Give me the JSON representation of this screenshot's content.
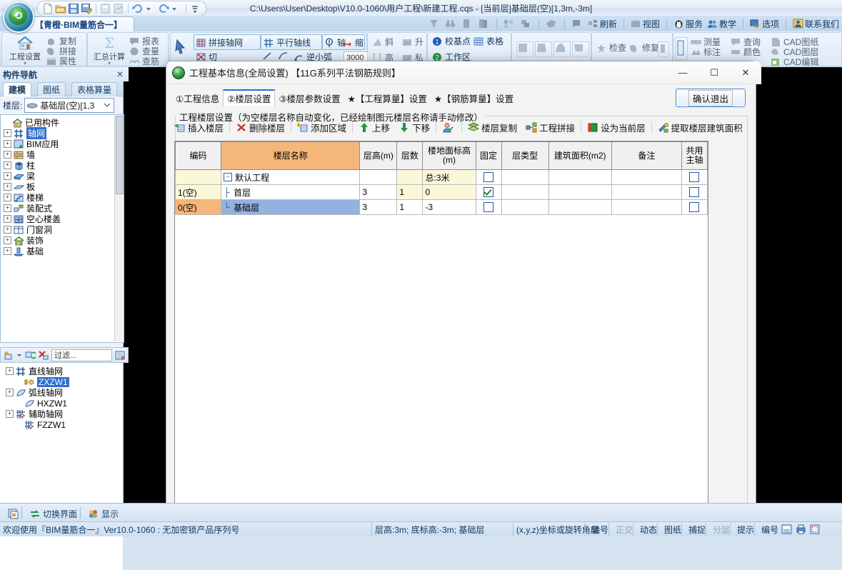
{
  "window": {
    "title": "C:\\Users\\User\\Desktop\\V10.0-1060\\用户工程\\新建工程.cqs  -  [当前层]基础层(空)[1,3m,-3m]",
    "doc_tab": "【青橙·BIM量筋合一】"
  },
  "quick_access": {
    "icons": [
      "new-file-icon",
      "open-folder-icon",
      "save-icon",
      "save-as-icon",
      "import-icon",
      "export-icon",
      "undo-icon",
      "undo-dropdown-icon",
      "redo-icon",
      "redo-dropdown-icon",
      "customize-qat-icon"
    ]
  },
  "topright": {
    "items": [
      {
        "label": "",
        "icon": "funnel-icon"
      },
      {
        "label": "",
        "icon": "binoculars-icon"
      },
      {
        "label": "",
        "icon": "page-icon"
      },
      {
        "label": "",
        "icon": "pages-icon"
      },
      {
        "label": "",
        "icon": "layout-icon"
      },
      {
        "label": "",
        "icon": "arrange-icon"
      },
      {
        "label": "",
        "icon": "tag-icon"
      },
      {
        "label": "",
        "icon": "flag-icon"
      },
      {
        "label": "刷新",
        "icon": "refresh-icon"
      },
      {
        "label": "视图",
        "icon": "view-icon"
      },
      {
        "label": "服务",
        "icon": "penguin-icon"
      },
      {
        "label": "教学",
        "icon": "people-icon"
      },
      {
        "label": "选项",
        "icon": "options-icon"
      },
      {
        "label": "联系我们",
        "icon": "contact-icon"
      }
    ]
  },
  "ribbon": {
    "groups": [
      {
        "big": {
          "label": "工程设置",
          "icon": "house-settings-icon"
        },
        "items": [
          {
            "label": "复制",
            "icon": "copy-icon"
          },
          {
            "label": "拼接",
            "icon": "merge-icon"
          },
          {
            "label": "属性",
            "icon": "properties-icon"
          }
        ]
      },
      {
        "big": {
          "label": "汇总计算",
          "icon": "sigma-icon"
        },
        "items": [
          {
            "label": "报表",
            "icon": "report-icon"
          },
          {
            "label": "查量",
            "icon": "query-quantity-icon"
          },
          {
            "label": "查筋",
            "icon": "query-rebar-icon"
          }
        ]
      },
      {
        "big": {
          "label": "",
          "icon": "cursor-icon"
        },
        "items": [
          {
            "label": "拼接轴网",
            "icon": "grid-merge-icon"
          },
          {
            "label": "切",
            "icon": "cut-grid-icon"
          },
          {
            "label": "平行轴线",
            "icon": "parallel-axis-icon"
          },
          {
            "label": "轴",
            "icon": "axis-icon"
          },
          {
            "label": "缩",
            "icon": "scale-icon"
          },
          {
            "label": "逆小弧",
            "icon": "arc-icon"
          },
          {
            "label": "3000",
            "icon": "spacing-input"
          }
        ]
      },
      {
        "big": {
          "label": "",
          "icon": ""
        },
        "items": [
          {
            "label": "斜",
            "icon": "slope-icon"
          },
          {
            "label": "升",
            "icon": "raise-icon"
          },
          {
            "label": "高",
            "icon": "height-icon"
          },
          {
            "label": "私",
            "icon": "private-icon"
          }
        ]
      },
      {
        "big": {
          "label": "",
          "icon": ""
        },
        "items": [
          {
            "label": "校基点",
            "icon": "badge-1-icon"
          },
          {
            "label": "表格",
            "icon": "table-icon"
          },
          {
            "label": "工作区",
            "icon": "badge-2-icon"
          }
        ]
      },
      {
        "big": {
          "label": "",
          "icon": ""
        },
        "items": [
          {
            "label": "",
            "icon": "shape-1-icon"
          },
          {
            "label": "",
            "icon": "shape-2-icon"
          },
          {
            "label": "",
            "icon": "shape-3-icon"
          },
          {
            "label": "",
            "icon": "shape-4-icon"
          }
        ]
      },
      {
        "big": {
          "label": "",
          "icon": ""
        },
        "items": [
          {
            "label": "检查",
            "icon": "check-icon"
          },
          {
            "label": "修复",
            "icon": "repair-icon"
          },
          {
            "label": "",
            "icon": "more-icon"
          }
        ]
      },
      {
        "big": {
          "label": "",
          "icon": ""
        },
        "items": [
          {
            "label": "测量",
            "icon": "measure-icon"
          },
          {
            "label": "查询",
            "icon": "search-icon"
          },
          {
            "label": "CAD图纸",
            "icon": "cad-drawing-icon"
          },
          {
            "label": "标注",
            "icon": "dimension-icon"
          },
          {
            "label": "颜色",
            "icon": "color-icon"
          },
          {
            "label": "CAD图层",
            "icon": "cad-layer-icon"
          },
          {
            "label": "CAD编辑",
            "icon": "cad-edit-icon"
          }
        ]
      }
    ]
  },
  "sidebar": {
    "title": "构件导航",
    "close_icon": "close-icon",
    "tabs": [
      {
        "label": "建模",
        "selected": true
      },
      {
        "label": "图纸",
        "selected": false
      },
      {
        "label": "表格算量",
        "selected": false
      }
    ],
    "floor_label": "楼层:",
    "floor_value": "基础层(空)[1,3",
    "tree": [
      {
        "label": "已用构件",
        "icon": "house-icon",
        "expandable": false,
        "indent": 1,
        "selected": false
      },
      {
        "label": "轴网",
        "icon": "grid-icon",
        "expandable": true,
        "indent": 1,
        "selected": true
      },
      {
        "label": "BIM应用",
        "icon": "bim-icon",
        "expandable": true,
        "indent": 1,
        "selected": false
      },
      {
        "label": "墙",
        "icon": "wall-icon",
        "expandable": true,
        "indent": 1,
        "selected": false
      },
      {
        "label": "柱",
        "icon": "column-icon",
        "expandable": true,
        "indent": 1,
        "selected": false
      },
      {
        "label": "梁",
        "icon": "beam-icon",
        "expandable": true,
        "indent": 1,
        "selected": false
      },
      {
        "label": "板",
        "icon": "slab-icon",
        "expandable": true,
        "indent": 1,
        "selected": false
      },
      {
        "label": "楼梯",
        "icon": "stair-icon",
        "expandable": true,
        "indent": 1,
        "selected": false
      },
      {
        "label": "装配式",
        "icon": "prefab-icon",
        "expandable": true,
        "indent": 1,
        "selected": false
      },
      {
        "label": "空心楼盖",
        "icon": "hollow-slab-icon",
        "expandable": true,
        "indent": 1,
        "selected": false
      },
      {
        "label": "门窗洞",
        "icon": "door-window-icon",
        "expandable": true,
        "indent": 1,
        "selected": false
      },
      {
        "label": "装饰",
        "icon": "decoration-icon",
        "expandable": true,
        "indent": 1,
        "selected": false
      },
      {
        "label": "基础",
        "icon": "foundation-icon",
        "expandable": true,
        "indent": 1,
        "selected": false
      }
    ],
    "filter": {
      "add_icon": "add-icon",
      "dropdown_icon": "dropdown-icon",
      "copy_icon": "copy-item-icon",
      "delete_icon": "delete-icon",
      "placeholder": "过滤...",
      "tool_icon": "filter-tool-icon"
    },
    "tree2": [
      {
        "label": "直线轴网",
        "icon": "line-grid-icon",
        "expandable": true,
        "indent": 1,
        "selected": false
      },
      {
        "label": "ZXZW1",
        "icon": "pointer-item-icon",
        "expandable": false,
        "indent": 2,
        "selected": true
      },
      {
        "label": "弧线轴网",
        "icon": "arc-grid-icon",
        "expandable": true,
        "indent": 1,
        "selected": false
      },
      {
        "label": "HXZW1",
        "icon": "arc-grid-icon",
        "expandable": false,
        "indent": 2,
        "selected": false
      },
      {
        "label": "辅助轴网",
        "icon": "aux-grid-icon",
        "expandable": true,
        "indent": 1,
        "selected": false
      },
      {
        "label": "FZZW1",
        "icon": "aux-grid-icon",
        "expandable": false,
        "indent": 2,
        "selected": false
      }
    ]
  },
  "dialog": {
    "title": "工程基本信息(全局设置) 【11G系列平法钢筋规则】",
    "app_icon": "app-orb-icon",
    "window_controls": {
      "minimize": "—",
      "maximize": "☐",
      "close": "✕"
    },
    "tabs": [
      {
        "label": "①工程信息",
        "selected": false
      },
      {
        "label": "②楼层设置",
        "selected": true
      },
      {
        "label": "③楼层参数设置",
        "selected": false
      },
      {
        "label": "★【工程算量】设置",
        "selected": false
      },
      {
        "label": "★【钢筋算量】设置",
        "selected": false
      }
    ],
    "confirm_label": "确认退出",
    "group_caption": "工程楼层设置（为空楼层名称自动变化，已经绘制图元楼层名称请手动修改）",
    "toolbar": [
      {
        "label": "插入楼层",
        "icon": "insert-floor-icon"
      },
      {
        "label": "删除楼层",
        "icon": "delete-floor-icon"
      },
      {
        "label": "添加区域",
        "icon": "add-area-icon"
      },
      {
        "label": "上移",
        "icon": "move-up-icon"
      },
      {
        "label": "下移",
        "icon": "move-down-icon"
      },
      {
        "label": "",
        "icon": "user-check-icon"
      },
      {
        "label": "楼层复制",
        "icon": "floor-copy-icon"
      },
      {
        "label": "工程拼接",
        "icon": "project-merge-icon"
      },
      {
        "label": "设为当前层",
        "icon": "set-current-floor-icon"
      },
      {
        "label": "提取楼层建筑面积",
        "icon": "extract-area-icon"
      }
    ],
    "table": {
      "columns": [
        "编码",
        "楼层名称",
        "层高(m)",
        "层数",
        "楼地面标高(m)",
        "固定",
        "层类型",
        "建筑面积(m2)",
        "备注",
        "共用主轴"
      ],
      "rows": [
        {
          "code": "",
          "name": "默认工程",
          "name_kind": "root",
          "height": "",
          "count": "",
          "elevation": "总:3米",
          "fixed": false,
          "floor_type": "",
          "area": "",
          "remark": "",
          "shared_axis": false,
          "selected": false
        },
        {
          "code": "1(空)",
          "name": "首层",
          "name_kind": "child",
          "height": "3",
          "count": "1",
          "elevation": "0",
          "fixed": true,
          "floor_type": "",
          "area": "",
          "remark": "",
          "shared_axis": false,
          "selected": false
        },
        {
          "code": "0(空)",
          "name": "基础层",
          "name_kind": "last",
          "height": "3",
          "count": "1",
          "elevation": "-3",
          "fixed": false,
          "floor_type": "",
          "area": "",
          "remark": "",
          "shared_axis": false,
          "selected": true
        }
      ]
    }
  },
  "bottombar": {
    "items": [
      {
        "label": "",
        "icon": "restore-window-icon"
      },
      {
        "label": "切换界面",
        "icon": "switch-ui-icon"
      },
      {
        "label": "显示",
        "icon": "display-icon"
      }
    ]
  },
  "statusbar": {
    "message": "欢迎使用『BIM量筋合一』Ver10.0-1060 : 无加密锁产品序列号",
    "floor_info": "层高:3m; 底标高:-3m; 基础层",
    "coord": "(x,y,z)坐标或旋转角度",
    "toggles": [
      {
        "label": "轴号",
        "active": true
      },
      {
        "label": "正交",
        "active": false
      },
      {
        "label": "动态",
        "active": true
      },
      {
        "label": "图纸",
        "active": true
      },
      {
        "label": "捕捉",
        "active": true
      },
      {
        "label": "分层",
        "active": false
      },
      {
        "label": "提示",
        "active": true
      },
      {
        "label": "编号",
        "active": true
      }
    ],
    "icons": [
      "calculator-icon",
      "print-icon",
      "window-icon"
    ]
  },
  "colors": {
    "accent": "#1e6fd9",
    "header_orange": "#f5b67a",
    "row_select": "#93b2e0",
    "code_yellow": "#fbf8da",
    "canvas": "#000000"
  }
}
